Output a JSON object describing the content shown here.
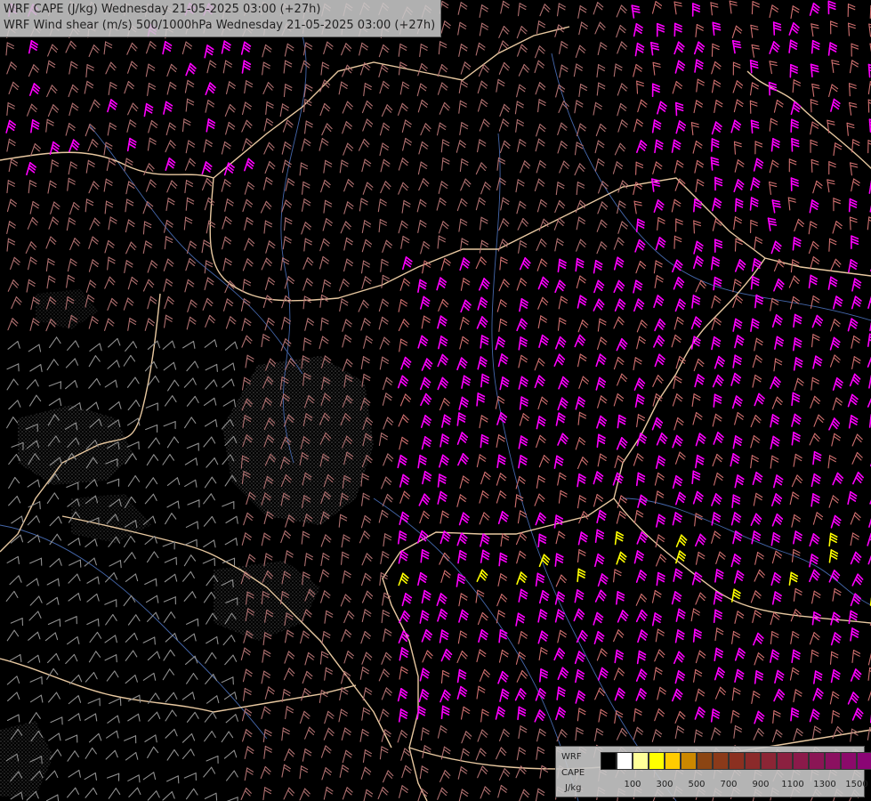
{
  "title": {
    "line1": "WRF CAPE (J/kg) Wednesday 21-05-2025 03:00 (+27h)",
    "line2": "WRF Wind shear (m/s) 500/1000hPa Wednesday 21-05-2025 03:00 (+27h)"
  },
  "legend": {
    "label_model": "WRF",
    "label_field": "CAPE",
    "label_unit": "J/kg",
    "colors": [
      "#000000",
      "#ffffff",
      "#ffff99",
      "#ffff00",
      "#ffcc00",
      "#cc8800",
      "#8b4513",
      "#8b3a1a",
      "#8b3020",
      "#8b2a2a",
      "#8b2535",
      "#8b2040",
      "#8b1a4a",
      "#8b1555",
      "#8b1060",
      "#8b0a6a",
      "#8b0575"
    ],
    "ticks": [
      {
        "label": "100",
        "pos": 1
      },
      {
        "label": "300",
        "pos": 3
      },
      {
        "label": "500",
        "pos": 5
      },
      {
        "label": "700",
        "pos": 7
      },
      {
        "label": "900",
        "pos": 9
      },
      {
        "label": "1100",
        "pos": 11
      },
      {
        "label": "1300",
        "pos": 13
      },
      {
        "label": "1500",
        "pos": 15
      }
    ]
  },
  "colors": {
    "background": "#000000",
    "barb_default": "#b07070",
    "barb_mid": "#d07070",
    "barb_high": "#ff00ff",
    "barb_gray": "#909090",
    "barb_yellow": "#ffff00",
    "border": "#e8c8a0",
    "river": "#4466aa",
    "cape_hatch": "#8c8c8c"
  }
}
